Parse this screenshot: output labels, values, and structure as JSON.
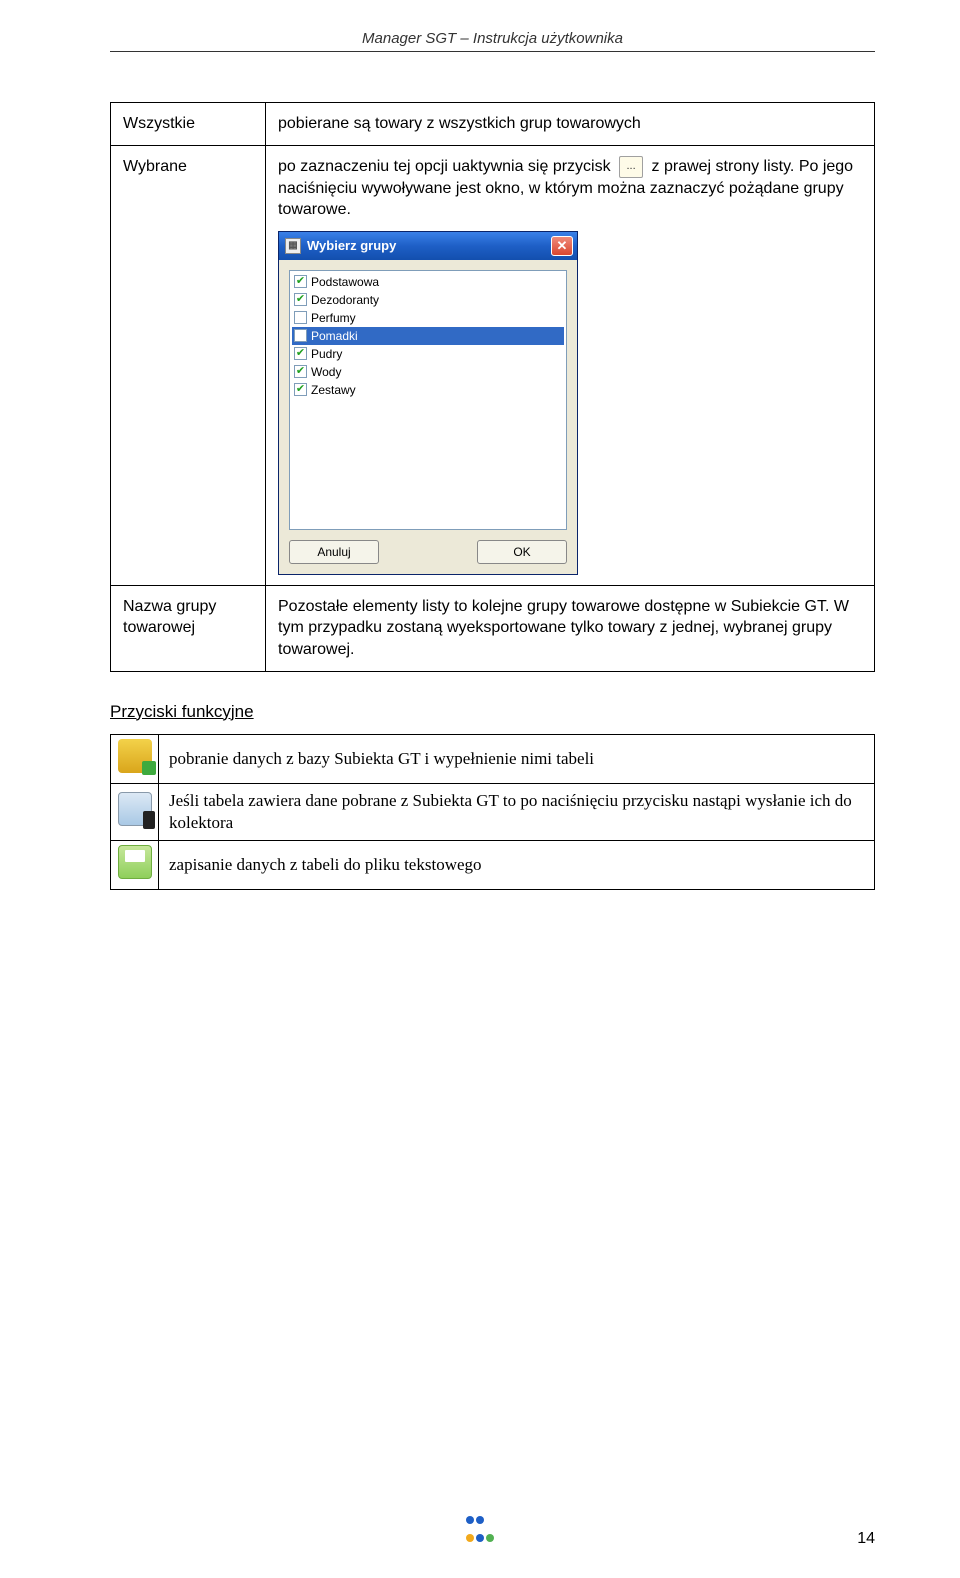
{
  "header": {
    "title": "Manager SGT – Instrukcja użytkownika"
  },
  "rows": {
    "r1": {
      "label": "Wszystkie",
      "desc": "pobierane są towary z wszystkich grup towarowych"
    },
    "r2": {
      "label": "Wybrane",
      "desc_a": "po zaznaczeniu tej opcji uaktywnia się przycisk",
      "desc_b": "z prawej strony listy. Po jego naciśnięciu wywoływane jest okno, w którym można zaznaczyć pożądane grupy towarowe.",
      "btn": "..."
    },
    "r3": {
      "label": "Nazwa grupy towarowej",
      "desc": "Pozostałe elementy listy to kolejne grupy towarowe dostępne w Subiekcie GT. W tym przypadku zostaną wyeksportowane tylko towary z jednej, wybranej grupy towarowej."
    }
  },
  "dialog": {
    "title": "Wybierz grupy",
    "items": [
      {
        "label": "Podstawowa",
        "checked": true,
        "selected": false
      },
      {
        "label": "Dezodoranty",
        "checked": true,
        "selected": false
      },
      {
        "label": "Perfumy",
        "checked": false,
        "selected": false
      },
      {
        "label": "Pomadki",
        "checked": false,
        "selected": true
      },
      {
        "label": "Pudry",
        "checked": true,
        "selected": false
      },
      {
        "label": "Wody",
        "checked": true,
        "selected": false
      },
      {
        "label": "Zestawy",
        "checked": true,
        "selected": false
      }
    ],
    "cancel": "Anuluj",
    "ok": "OK"
  },
  "section": {
    "heading": "Przyciski funkcyjne"
  },
  "icon_rows": {
    "i1": "pobranie danych z bazy Subiekta GT i wypełnienie nimi tabeli",
    "i2": "Jeśli tabela zawiera dane pobrane z Subiekta GT to po naciśnięciu przycisku nastąpi wysłanie ich do kolektora",
    "i3": "zapisanie danych z tabeli do pliku tekstowego"
  },
  "page_number": "14"
}
